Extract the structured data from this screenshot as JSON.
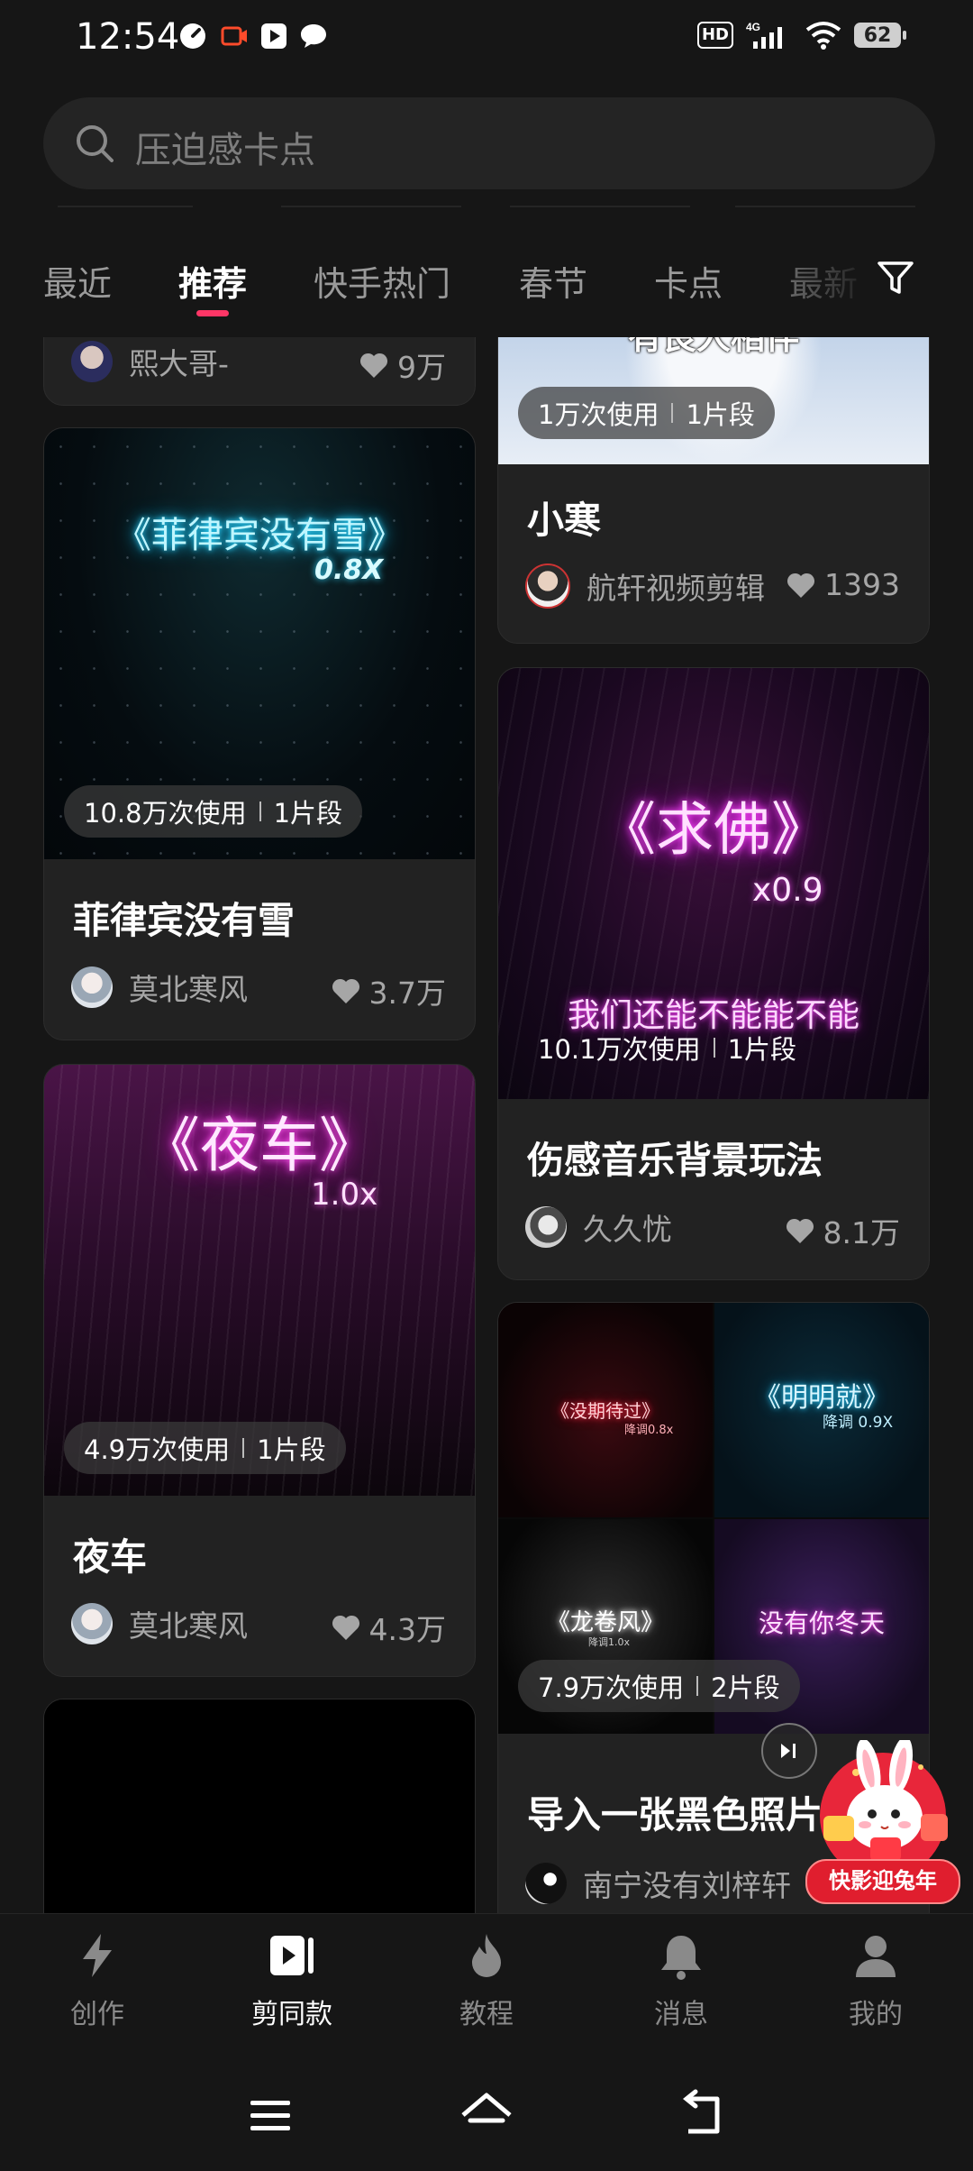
{
  "status": {
    "time": "12:54",
    "hd": "HD",
    "network": "4G",
    "battery": "62"
  },
  "search": {
    "placeholder": "压迫感卡点"
  },
  "tabs": [
    {
      "label": "最近"
    },
    {
      "label": "推荐"
    },
    {
      "label": "快手热门"
    },
    {
      "label": "春节"
    },
    {
      "label": "卡点"
    },
    {
      "label": "最新"
    }
  ],
  "cards": {
    "top_left": {
      "author": "熙大哥-",
      "likes": "9万"
    },
    "top_right": {
      "thumb_text": "有良人相伴",
      "uses": "1万次使用",
      "segments": "1片段",
      "title": "小寒",
      "author": "航轩视频剪辑",
      "likes": "1393"
    },
    "feilvbin": {
      "thumb_text": "《菲律宾没有雪》",
      "speed": "0.8X",
      "uses": "10.8万次使用",
      "segments": "1片段",
      "title": "菲律宾没有雪",
      "author": "莫北寒风",
      "likes": "3.7万"
    },
    "qiufo": {
      "thumb_text": "《求佛》",
      "speed": "x0.9",
      "lyric": "我们还能不能能不能",
      "uses": "10.1万次使用",
      "segments": "1片段",
      "title": "伤感音乐背景玩法",
      "author": "久久忧",
      "likes": "8.1万"
    },
    "yeche": {
      "thumb_text": "《夜车》",
      "speed": "1.0x",
      "uses": "4.9万次使用",
      "segments": "1片段",
      "title": "夜车",
      "author": "莫北寒风",
      "likes": "4.3万"
    },
    "collage": {
      "q1": "《没期待过》",
      "q1_sub": "降调0.8x",
      "q2": "《明明就》",
      "q2_sub": "降调 0.9X",
      "q3": "《龙卷风》",
      "q3_sub": "降调1.0x",
      "q4": "没有你冬天",
      "uses": "7.9万次使用",
      "segments": "2片段",
      "title": "导入一张黑色照片",
      "author": "南宁没有刘梓轩"
    }
  },
  "promo": {
    "label": "快影迎兔年"
  },
  "nav": [
    {
      "label": "创作",
      "icon": "lightning-icon"
    },
    {
      "label": "剪同款",
      "icon": "play-square-icon"
    },
    {
      "label": "教程",
      "icon": "flame-icon"
    },
    {
      "label": "消息",
      "icon": "bell-icon"
    },
    {
      "label": "我的",
      "icon": "person-icon"
    }
  ],
  "colors": {
    "accent": "#fe3666",
    "background": "#161616",
    "card": "#222222"
  }
}
